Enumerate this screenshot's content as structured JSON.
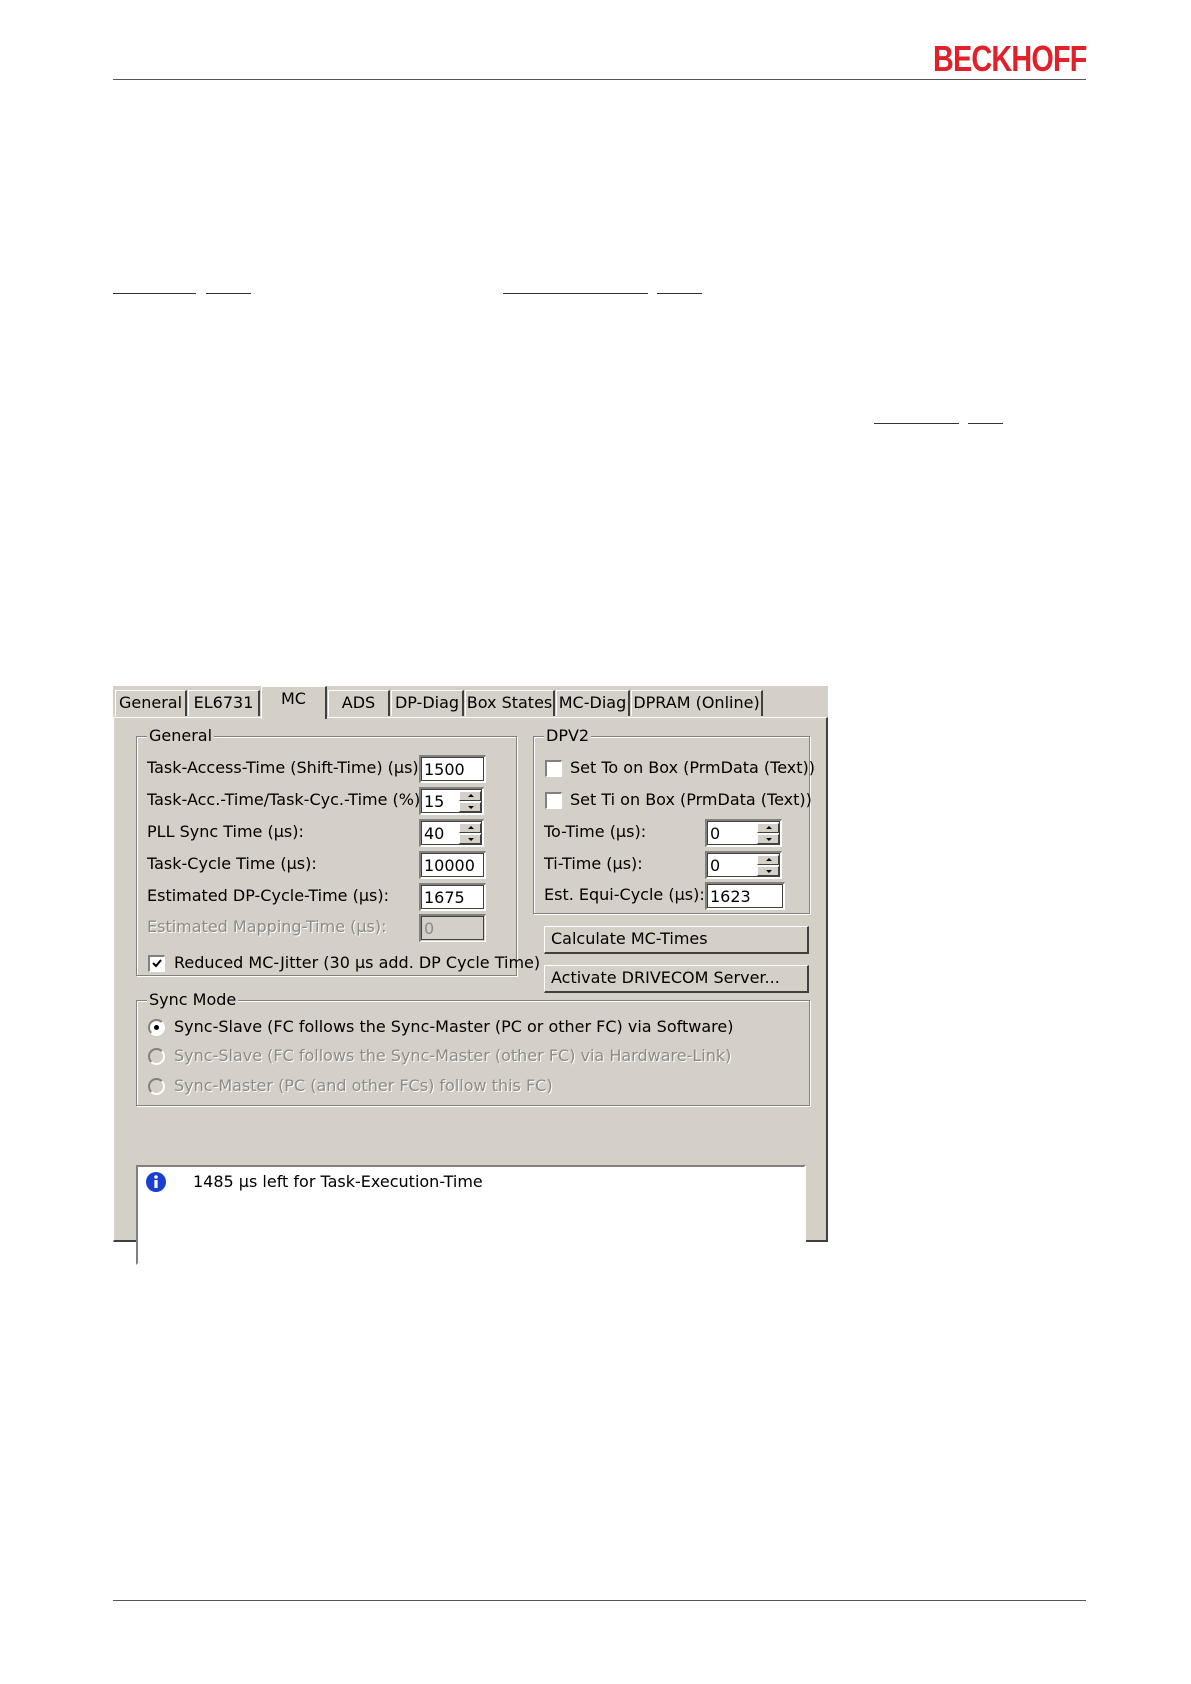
{
  "header": {
    "brand": "BECKHOFF"
  },
  "dialog": {
    "tabs": [
      {
        "label": "General"
      },
      {
        "label": "EL6731"
      },
      {
        "label": "MC"
      },
      {
        "label": "ADS"
      },
      {
        "label": "DP-Diag"
      },
      {
        "label": "Box States"
      },
      {
        "label": "MC-Diag"
      },
      {
        "label": "DPRAM (Online)"
      }
    ],
    "active_tab": "MC",
    "general": {
      "title": "General",
      "fields": [
        {
          "label": "Task-Access-Time (Shift-Time) (µs):",
          "value": "1500"
        },
        {
          "label": "Task-Acc.-Time/Task-Cyc.-Time (%):",
          "value": "15"
        },
        {
          "label": "PLL Sync Time (µs):",
          "value": "40"
        },
        {
          "label": "Task-Cycle Time (µs):",
          "value": "10000"
        },
        {
          "label": "Estimated DP-Cycle-Time (µs):",
          "value": "1675"
        },
        {
          "label": "Estimated Mapping-Time (µs):",
          "value": "0"
        }
      ],
      "jitter_label": "Reduced MC-Jitter (30 µs add. DP Cycle Time)",
      "jitter_checked": true
    },
    "dpv2": {
      "title": "DPV2",
      "set_to_label": "Set To on Box (PrmData (Text))",
      "set_ti_label": "Set Ti on Box (PrmData (Text))",
      "set_to_checked": false,
      "set_ti_checked": false,
      "to_time_label": "To-Time (µs):",
      "to_time_value": "0",
      "ti_time_label": "Ti-Time (µs):",
      "ti_time_value": "0",
      "equi_label": "Est. Equi-Cycle (µs):",
      "equi_value": "1623"
    },
    "buttons": {
      "calculate": "Calculate MC-Times",
      "activate": "Activate DRIVECOM Server..."
    },
    "sync_mode": {
      "title": "Sync Mode",
      "options": [
        {
          "label": "Sync-Slave (FC follows the Sync-Master (PC or other FC) via Software)",
          "selected": true,
          "enabled": true
        },
        {
          "label": "Sync-Slave (FC follows the Sync-Master (other FC) via Hardware-Link)",
          "selected": false,
          "enabled": false
        },
        {
          "label": "Sync-Master (PC (and other FCs) follow this FC)",
          "selected": false,
          "enabled": false
        }
      ]
    },
    "message": {
      "icon": "info-icon",
      "text": "1485 µs left for Task-Execution-Time"
    }
  },
  "colors": {
    "brand": "#e2202a",
    "dialog_bg": "#d4d0c8",
    "info_icon": "#1a3fd0"
  }
}
